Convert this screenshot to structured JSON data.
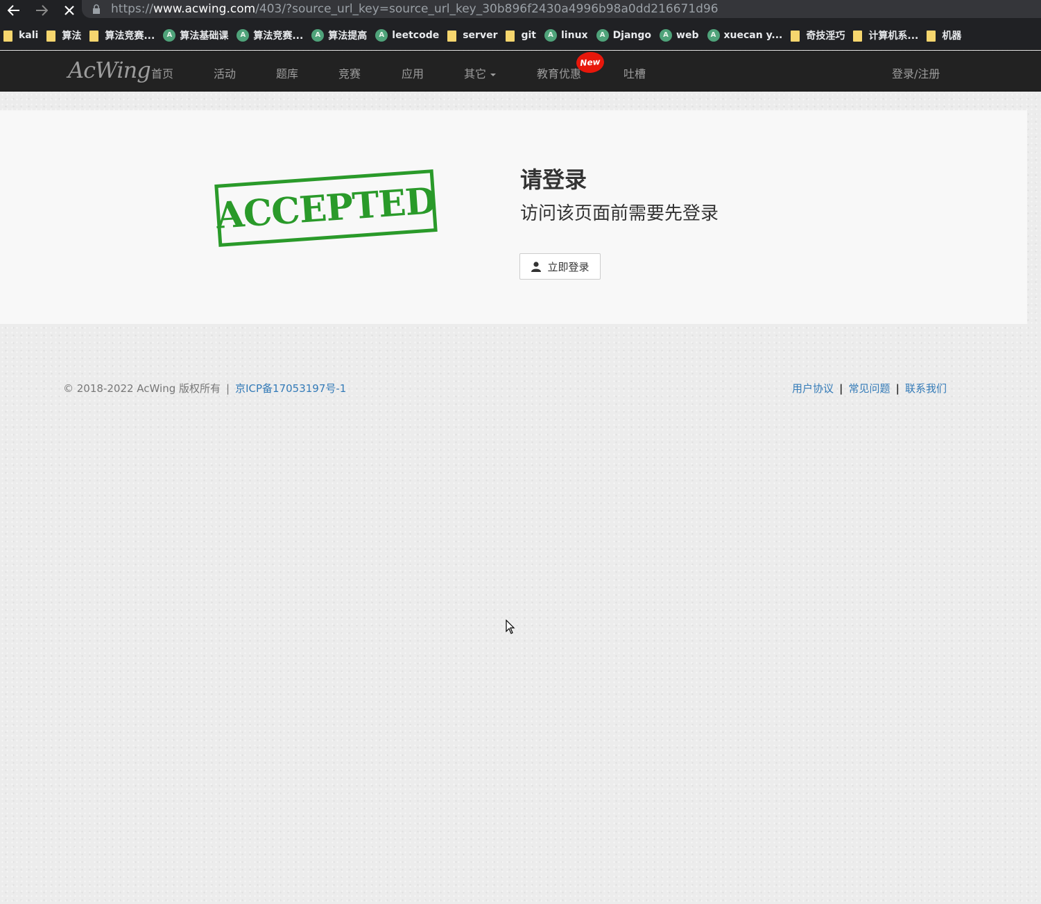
{
  "browser": {
    "url_scheme": "https://",
    "url_host": "www.acwing.com",
    "url_path": "/403/?source_url_key=source_url_key_30b896f2430a4996b98a0dd216671d96",
    "bookmarks": [
      {
        "label": "kali",
        "type": "folder"
      },
      {
        "label": "算法",
        "type": "folder"
      },
      {
        "label": "算法竞赛...",
        "type": "folder"
      },
      {
        "label": "算法基础课",
        "type": "site"
      },
      {
        "label": "算法竞赛...",
        "type": "site"
      },
      {
        "label": "算法提高",
        "type": "site"
      },
      {
        "label": "leetcode",
        "type": "site"
      },
      {
        "label": "server",
        "type": "folder"
      },
      {
        "label": "git",
        "type": "folder"
      },
      {
        "label": "linux",
        "type": "site"
      },
      {
        "label": "Django",
        "type": "site"
      },
      {
        "label": "web",
        "type": "site"
      },
      {
        "label": "xuecan y...",
        "type": "site"
      },
      {
        "label": "奇技淫巧",
        "type": "folder"
      },
      {
        "label": "计算机系...",
        "type": "folder"
      },
      {
        "label": "机器",
        "type": "folder"
      }
    ]
  },
  "nav": {
    "logo": "AcWing",
    "items": [
      "首页",
      "活动",
      "题库",
      "竞赛",
      "应用",
      "其它",
      "教育优惠",
      "吐槽"
    ],
    "badge": "New",
    "login_register": "登录/注册"
  },
  "main": {
    "stamp_text": "ACCEPTED",
    "title": "请登录",
    "subtitle": "访问该页面前需要先登录",
    "login_button": "立即登录"
  },
  "footer": {
    "copyright": "© 2018-2022 AcWing 版权所有",
    "sep": "|",
    "icp": "京ICP备17053197号-1",
    "links": [
      "用户协议",
      "常见问题",
      "联系我们"
    ]
  },
  "colors": {
    "accent_link": "#337ab7",
    "stamp_green": "#2a9a2a",
    "badge_red": "#e8170b",
    "nav_bg": "#222222"
  }
}
